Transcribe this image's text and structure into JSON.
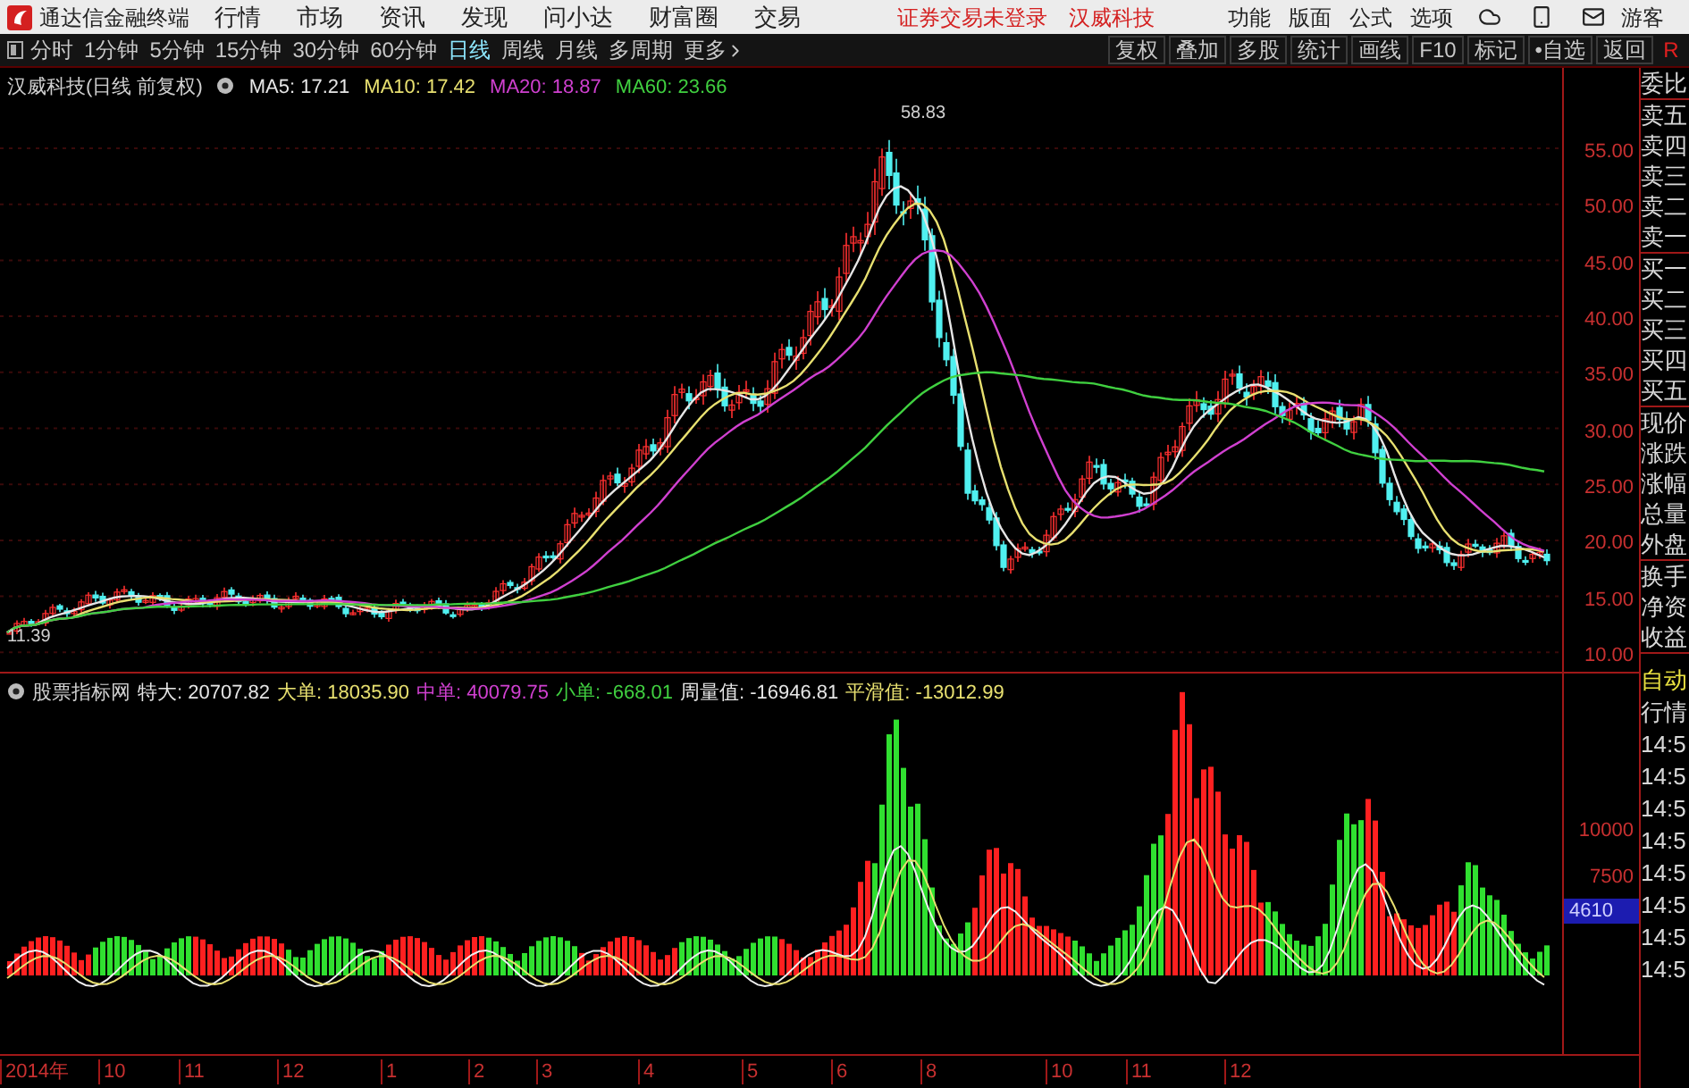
{
  "app": {
    "title": "通达信金融终端",
    "menu": [
      "行情",
      "市场",
      "资讯",
      "发现",
      "问小达",
      "财富圈",
      "交易"
    ],
    "status_text": "证券交易未登录",
    "stock_name": "汉威科技",
    "tools": [
      "功能",
      "版面",
      "公式",
      "选项"
    ],
    "user": "游客"
  },
  "period_tabs": [
    {
      "label": "分时",
      "selected": false
    },
    {
      "label": "1分钟",
      "selected": false
    },
    {
      "label": "5分钟",
      "selected": false
    },
    {
      "label": "15分钟",
      "selected": false
    },
    {
      "label": "30分钟",
      "selected": false
    },
    {
      "label": "60分钟",
      "selected": false
    },
    {
      "label": "日线",
      "selected": true
    },
    {
      "label": "周线",
      "selected": false
    },
    {
      "label": "月线",
      "selected": false
    },
    {
      "label": "多周期",
      "selected": false
    },
    {
      "label": "更多",
      "selected": false
    }
  ],
  "chart_tools": [
    "复权",
    "叠加",
    "多股",
    "统计",
    "画线",
    "F10",
    "标记",
    "•自选",
    "返回"
  ],
  "corner_mark": "R",
  "price_chart": {
    "title": "汉威科技(日线 前复权)",
    "ma": [
      {
        "label": "MA5: 17.21",
        "color": "#e6e6e6"
      },
      {
        "label": "MA10: 17.42",
        "color": "#e8e070"
      },
      {
        "label": "MA20: 18.87",
        "color": "#d040d0"
      },
      {
        "label": "MA60: 23.66",
        "color": "#40d040"
      }
    ],
    "high_label": "58.83",
    "low_label": "11.39",
    "y_labels": [
      "55.00",
      "50.00",
      "45.00",
      "40.00",
      "35.00",
      "30.00",
      "25.00",
      "20.00",
      "15.00",
      "10.00"
    ]
  },
  "indicator": {
    "name": "股票指标网",
    "values": [
      {
        "label": "特大:",
        "value": "20707.82",
        "color": "#e6e6e6"
      },
      {
        "label": "大单:",
        "value": "18035.90",
        "color": "#e8e070"
      },
      {
        "label": "中单:",
        "value": "40079.75",
        "color": "#d040d0"
      },
      {
        "label": "小单:",
        "value": "-668.01",
        "color": "#40d040"
      },
      {
        "label": "周量值:",
        "value": "-16946.81",
        "color": "#e6e6e6"
      },
      {
        "label": "平滑值:",
        "value": "-13012.99",
        "color": "#e8e070"
      }
    ],
    "y_labels": [
      "10000",
      "7500"
    ],
    "current": "4610"
  },
  "x_labels": [
    "2014年",
    "10",
    "11",
    "12",
    "1",
    "2",
    "3",
    "4",
    "5",
    "6",
    "8",
    "10",
    "11",
    "12"
  ],
  "quote_panel": {
    "groups": [
      [
        "委比"
      ],
      [
        "卖五",
        "卖四",
        "卖三",
        "卖二",
        "卖一"
      ],
      [
        "买一",
        "买二",
        "买三",
        "买四",
        "买五"
      ],
      [
        "现价",
        "涨跌",
        "涨幅",
        "总量",
        "外盘"
      ],
      [
        "换手",
        "净资",
        "收益"
      ]
    ],
    "mode": "自动",
    "trade_title": "行情",
    "times": [
      "14:5",
      "14:5",
      "14:5",
      "14:5",
      "14:5",
      "14:5",
      "14:5",
      "14:5"
    ]
  }
}
